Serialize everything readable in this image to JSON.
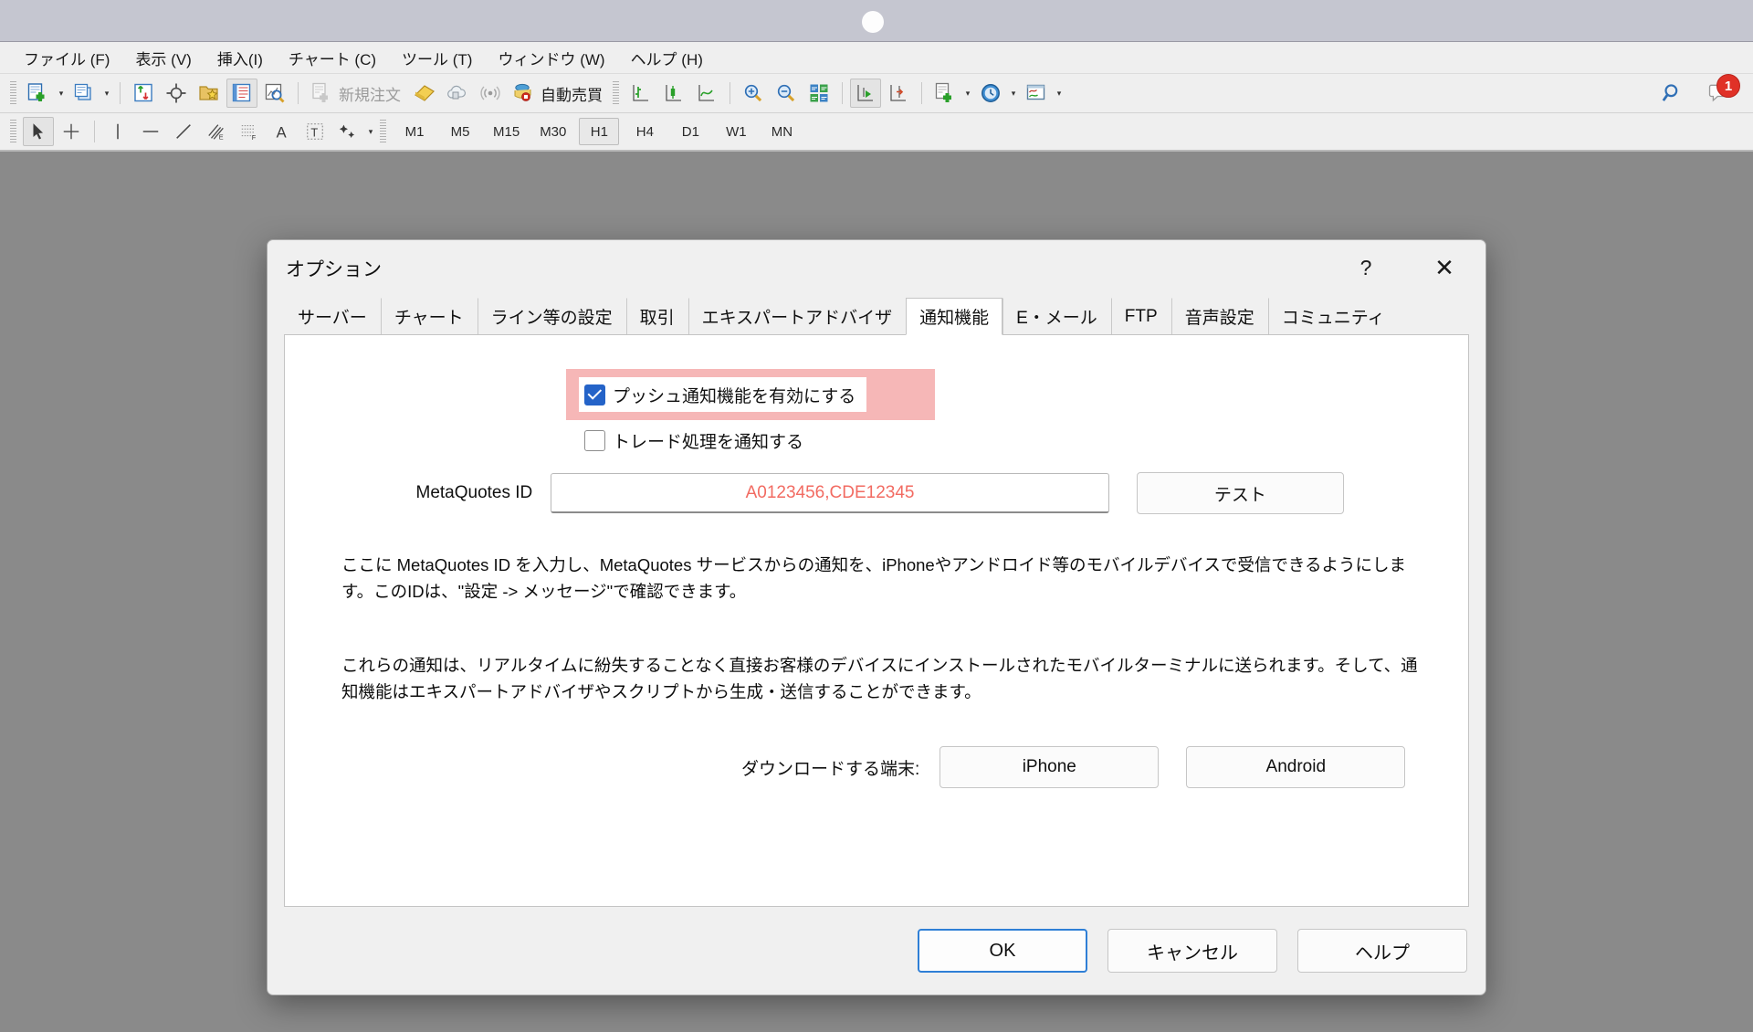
{
  "window": {
    "chrome_color": "#c5c6d0",
    "accent_color": "#2463c8",
    "highlight_color": "#f6b7b7",
    "id_text_color": "#f26b62"
  },
  "menubar": {
    "items": [
      {
        "label": "ファイル (F)",
        "name": "menu-file"
      },
      {
        "label": "表示 (V)",
        "name": "menu-view"
      },
      {
        "label": "挿入(I)",
        "name": "menu-insert"
      },
      {
        "label": "チャート (C)",
        "name": "menu-charts"
      },
      {
        "label": "ツール (T)",
        "name": "menu-tools"
      },
      {
        "label": "ウィンドウ (W)",
        "name": "menu-window"
      },
      {
        "label": "ヘルプ (H)",
        "name": "menu-help"
      }
    ]
  },
  "toolbar_main": {
    "new_chart_icon": "new-chart-icon",
    "profiles_icon": "profiles-icon",
    "market_watch_icon": "market-watch-icon",
    "data_window_icon": "data-window-icon",
    "navigator_icon": "navigator-icon",
    "terminal_icon": "terminal-icon",
    "strategy_tester_icon": "strategy-tester-icon",
    "new_order_icon": "new-order-icon",
    "new_order_label": "新規注文",
    "metaeditor_icon": "metaeditor-icon",
    "virtual_hosting_icon": "virtual-hosting-icon",
    "signals_icon": "signals-icon",
    "autotrading_icon": "autotrading-icon",
    "autotrading_label": "自動売買",
    "bar_chart_icon": "bar-chart-icon",
    "candle_chart_icon": "candlestick-chart-icon",
    "line_chart_icon": "line-chart-icon",
    "zoom_in_icon": "zoom-in-icon",
    "zoom_out_icon": "zoom-out-icon",
    "tile_windows_icon": "tile-windows-icon",
    "auto_scroll_icon": "auto-scroll-icon",
    "chart_shift_icon": "chart-shift-icon",
    "indicators_icon": "indicators-icon",
    "periods_icon": "periods-clock-icon",
    "templates_icon": "templates-icon",
    "search_icon": "search-icon",
    "notification_icon": "notification-bubble-icon",
    "notification_count": "1"
  },
  "toolbar_line_studies": {
    "cursor_icon": "cursor-arrow-icon",
    "crosshair_icon": "crosshair-icon",
    "vline_icon": "vertical-line-icon",
    "hline_icon": "horizontal-line-icon",
    "trendline_icon": "trendline-icon",
    "equidistant_icon": "equidistant-channel-icon",
    "fibonacci_icon": "fibonacci-retracement-icon",
    "text_icon": "text-icon",
    "label_icon": "text-label-icon",
    "shapes_icon": "shapes-icon",
    "timeframes": [
      {
        "label": "M1",
        "active": false
      },
      {
        "label": "M5",
        "active": false
      },
      {
        "label": "M15",
        "active": false
      },
      {
        "label": "M30",
        "active": false
      },
      {
        "label": "H1",
        "active": true
      },
      {
        "label": "H4",
        "active": false
      },
      {
        "label": "D1",
        "active": false
      },
      {
        "label": "W1",
        "active": false
      },
      {
        "label": "MN",
        "active": false
      }
    ]
  },
  "dialog": {
    "title": "オプション",
    "help_glyph": "?",
    "close_glyph": "✕",
    "tabs": [
      {
        "label": "サーバー",
        "active": false
      },
      {
        "label": "チャート",
        "active": false
      },
      {
        "label": "ライン等の設定",
        "active": false
      },
      {
        "label": "取引",
        "active": false
      },
      {
        "label": "エキスパートアドバイザ",
        "active": false
      },
      {
        "label": "通知機能",
        "active": true
      },
      {
        "label": "E・メール",
        "active": false
      },
      {
        "label": "FTP",
        "active": false
      },
      {
        "label": "音声設定",
        "active": false
      },
      {
        "label": "コミュニティ",
        "active": false
      }
    ],
    "notifications": {
      "enable_push_label": "プッシュ通知機能を有効にする",
      "enable_push_checked": true,
      "notify_trade_label": "トレード処理を通知する",
      "notify_trade_checked": false,
      "metaquotes_id_label": "MetaQuotes ID",
      "metaquotes_id_value": "A0123456,CDE12345",
      "metaquotes_id_placeholder": "A0123456,CDE12345",
      "test_button_label": "テスト",
      "paragraph_1": "ここに MetaQuotes ID を入力し、MetaQuotes サービスからの通知を、iPhoneやアンドロイド等のモバイルデバイスで受信できるようにします。このIDは、\"設定 -> メッセージ\"で確認できます。",
      "paragraph_2": "これらの通知は、リアルタイムに紛失することなく直接お客様のデバイスにインストールされたモバイルターミナルに送られます。そして、通知機能はエキスパートアドバイザやスクリプトから生成・送信することができます。",
      "download_label": "ダウンロードする端末:",
      "download_iphone_label": "iPhone",
      "download_android_label": "Android"
    },
    "footer": {
      "ok_label": "OK",
      "cancel_label": "キャンセル",
      "help_label": "ヘルプ"
    }
  }
}
